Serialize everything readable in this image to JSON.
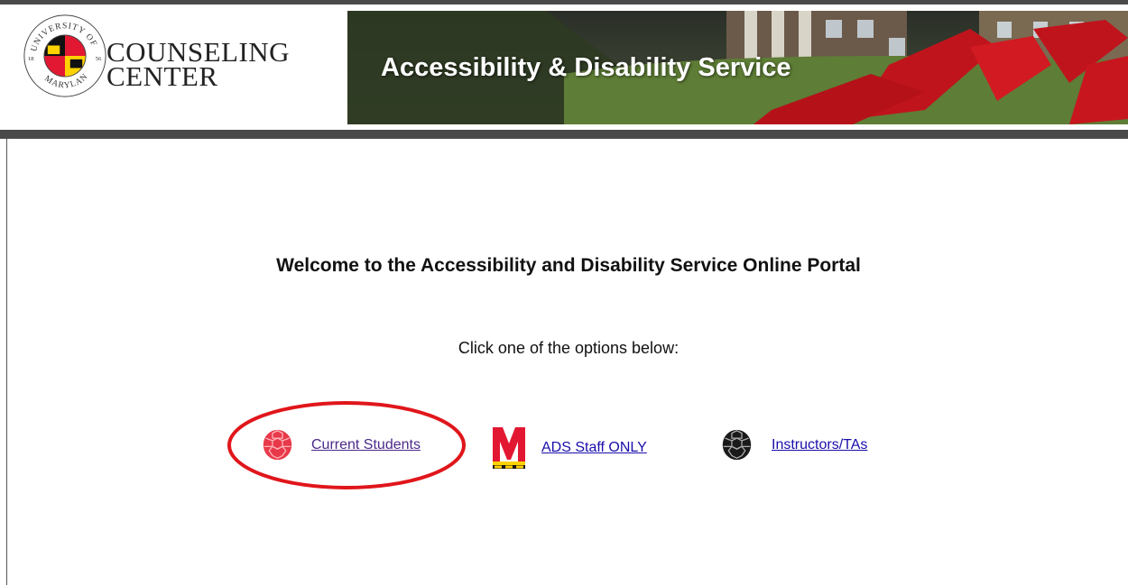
{
  "header": {
    "seal_text": "UNIVERSITY OF MARYLAND 1856",
    "brand_line1": "COUNSELING",
    "brand_line2": "CENTER",
    "banner_title": "Accessibility & Disability Service"
  },
  "main": {
    "welcome": "Welcome to the Accessibility and Disability Service Online Portal",
    "instruction": "Click one of the options below:",
    "options": [
      {
        "label": "Current Students",
        "icon": "red-turtle-shell-icon"
      },
      {
        "label": "ADS Staff ONLY",
        "icon": "maryland-m-logo-icon"
      },
      {
        "label": "Instructors/TAs",
        "icon": "black-turtle-shell-icon"
      }
    ]
  },
  "annotation": {
    "highlighted_option": "Current Students",
    "color": "#e0161b"
  },
  "colors": {
    "header_rule": "#4a4a4a",
    "link": "#1a0dab",
    "visited_link": "#4b2a8a",
    "umd_red": "#e21833",
    "umd_gold": "#ffd200"
  }
}
